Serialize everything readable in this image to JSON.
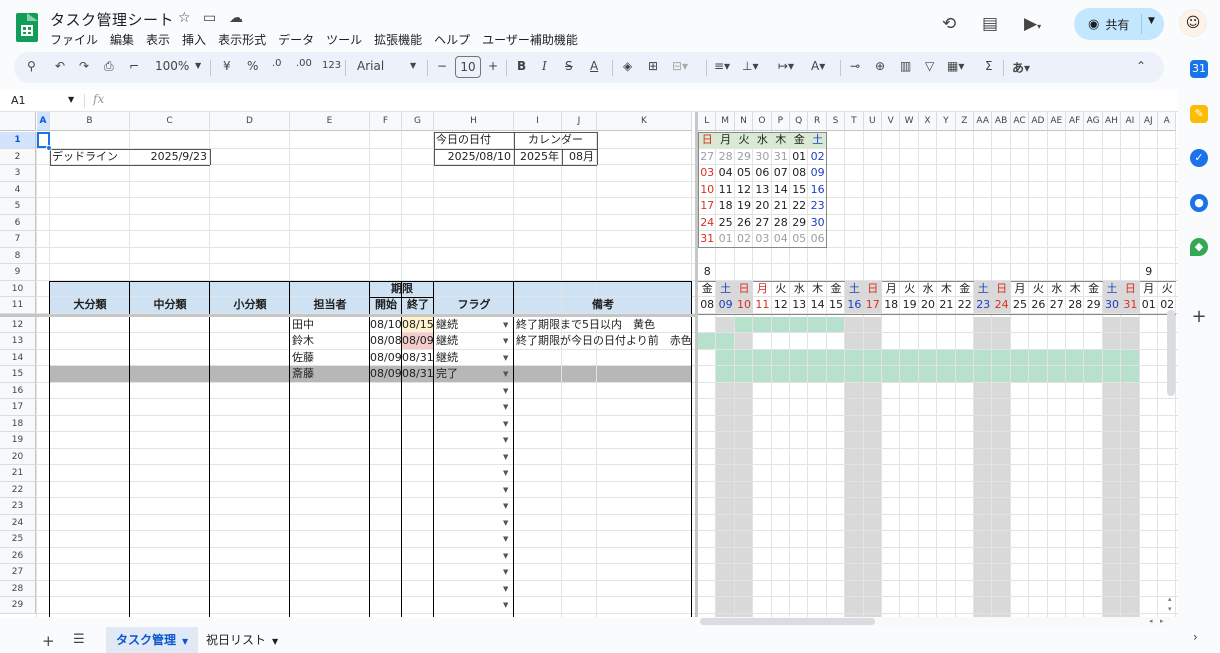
{
  "title": "タスク管理シート",
  "menu": [
    "ファイル",
    "編集",
    "表示",
    "挿入",
    "表示形式",
    "データ",
    "ツール",
    "拡張機能",
    "ヘルプ",
    "ユーザー補助機能"
  ],
  "share_label": "共有",
  "toolbar": {
    "zoom": "100%",
    "currency": "¥",
    "percent": "%",
    "dec_less": ".0",
    "dec_more": ".00",
    "format_more": "123",
    "font": "Arial",
    "font_size": "10"
  },
  "namebox": "A1",
  "fx": "fx",
  "columns": [
    {
      "id": "A",
      "w": 13
    },
    {
      "id": "B",
      "w": 80
    },
    {
      "id": "C",
      "w": 80
    },
    {
      "id": "D",
      "w": 80
    },
    {
      "id": "E",
      "w": 80
    },
    {
      "id": "F",
      "w": 32
    },
    {
      "id": "G",
      "w": 32
    },
    {
      "id": "H",
      "w": 80
    },
    {
      "id": "I",
      "w": 48
    },
    {
      "id": "J",
      "w": 35
    },
    {
      "id": "K",
      "w": 95
    }
  ],
  "cal_columns": [
    "L",
    "M",
    "N",
    "O",
    "P",
    "Q",
    "R",
    "S",
    "T",
    "U",
    "V",
    "W",
    "X",
    "Y",
    "Z",
    "AA",
    "AB",
    "AC",
    "AD",
    "AE",
    "AF",
    "AG",
    "AH",
    "AI",
    "AJ",
    "A"
  ],
  "rows": [
    "1",
    "2",
    "3",
    "4",
    "5",
    "6",
    "7",
    "8",
    "9",
    "10",
    "11",
    "12",
    "13",
    "14",
    "15",
    "16",
    "17",
    "18",
    "19",
    "20",
    "21",
    "22",
    "23",
    "24",
    "25",
    "26",
    "27",
    "28",
    "29"
  ],
  "info": {
    "deadline_label": "デッドライン",
    "deadline_value": "2025/9/23",
    "today_label": "今日の日付",
    "today_value": "2025/08/10",
    "calendar_label": "カレンダー",
    "calendar_year": "2025年",
    "calendar_month": "08月"
  },
  "task_headers": {
    "major": "大分類",
    "middle": "中分類",
    "minor": "小分類",
    "owner": "担当者",
    "period": "期限",
    "start": "開始",
    "end": "終了",
    "flag": "フラグ",
    "note": "備考"
  },
  "tasks": [
    {
      "owner": "田中",
      "start": "08/10",
      "end": "08/15",
      "flag": "継続",
      "note": "終了期限まで5日以内　黄色",
      "end_color": "#fff2cc",
      "row_color": ""
    },
    {
      "owner": "鈴木",
      "start": "08/08",
      "end": "08/09",
      "flag": "継続",
      "note": "終了期限が今日の日付より前　赤色",
      "end_color": "#f4cccc",
      "row_color": ""
    },
    {
      "owner": "佐藤",
      "start": "08/09",
      "end": "08/31",
      "flag": "継続",
      "note": "",
      "end_color": "",
      "row_color": ""
    },
    {
      "owner": "斎藤",
      "start": "08/09",
      "end": "08/31",
      "flag": "完了",
      "note": "",
      "end_color": "",
      "row_color": "#b7b7b7"
    }
  ],
  "mini_calendar": {
    "weekdays": [
      "日",
      "月",
      "火",
      "水",
      "木",
      "金",
      "土"
    ],
    "weeks": [
      [
        "27",
        "28",
        "29",
        "30",
        "31",
        "01",
        "02"
      ],
      [
        "03",
        "04",
        "05",
        "06",
        "07",
        "08",
        "09"
      ],
      [
        "10",
        "11",
        "12",
        "13",
        "14",
        "15",
        "16"
      ],
      [
        "17",
        "18",
        "19",
        "20",
        "21",
        "22",
        "23"
      ],
      [
        "24",
        "25",
        "26",
        "27",
        "28",
        "29",
        "30"
      ],
      [
        "31",
        "01",
        "02",
        "03",
        "04",
        "05",
        "06"
      ]
    ],
    "sunday_color": "#d93025",
    "saturday_color": "#1a3fc7",
    "other_month_color": "#9aa0a6",
    "header_color": "#d9ead3"
  },
  "gantt": {
    "month_label_start": "8",
    "month_label_next": "9",
    "weekdays": [
      "金",
      "土",
      "日",
      "月",
      "火",
      "水",
      "木",
      "金",
      "土",
      "日",
      "月",
      "火",
      "水",
      "木",
      "金",
      "土",
      "日",
      "月",
      "火",
      "水",
      "木",
      "金",
      "土",
      "日",
      "月",
      "火"
    ],
    "days": [
      "08",
      "09",
      "10",
      "11",
      "12",
      "13",
      "14",
      "15",
      "16",
      "17",
      "18",
      "19",
      "20",
      "21",
      "22",
      "23",
      "24",
      "25",
      "26",
      "27",
      "28",
      "29",
      "30",
      "31",
      "01",
      "02"
    ],
    "day_colors": [
      "",
      "sat",
      "sun",
      "hol",
      "",
      "",
      "",
      "",
      "sat",
      "sun",
      "",
      "",
      "",
      "",
      "",
      "sat",
      "sun",
      "",
      "",
      "",
      "",
      "",
      "sat",
      "sun",
      "",
      ""
    ],
    "weekend_cols": [
      1,
      2,
      8,
      9,
      15,
      16,
      22,
      23
    ],
    "bar_color": "#b7e1cd",
    "weekend_color": "#d9d9d9",
    "bars": [
      {
        "row": 0,
        "from": 2,
        "to": 7
      },
      {
        "row": 1,
        "from": 0,
        "to": 1
      },
      {
        "row": 2,
        "from": 1,
        "to": 23
      },
      {
        "row": 3,
        "from": 1,
        "to": 23
      }
    ]
  },
  "sheets": [
    {
      "name": "タスク管理",
      "active": true
    },
    {
      "name": "祝日リスト",
      "active": false
    }
  ],
  "colors": {
    "accent": "#0b57d0",
    "share_bg": "#c2e7ff",
    "header_fill": "#cfe2f3",
    "toolbar_bg": "#edf2fa"
  }
}
